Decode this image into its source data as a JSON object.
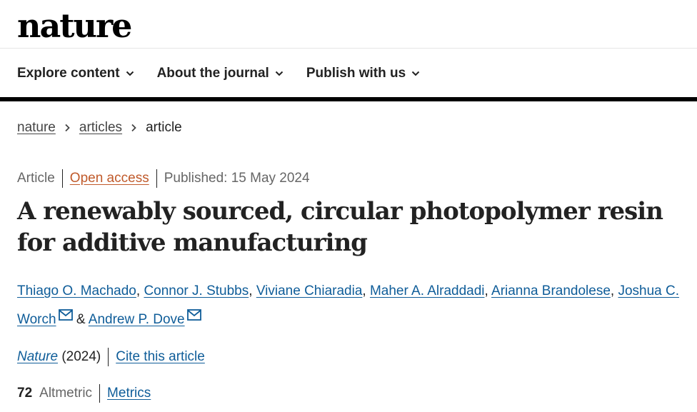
{
  "header": {
    "logo": "nature"
  },
  "nav": {
    "items": [
      {
        "label": "Explore content"
      },
      {
        "label": "About the journal"
      },
      {
        "label": "Publish with us"
      }
    ]
  },
  "breadcrumb": {
    "items": [
      "nature",
      "articles"
    ],
    "current": "article"
  },
  "article": {
    "type": "Article",
    "access": "Open access",
    "published": "Published: 15 May 2024",
    "title": "A renewably sourced, circular photopolymer resin for additive manufacturing",
    "authors": [
      "Thiago O. Machado",
      "Connor J. Stubbs",
      "Viviane Chiaradia",
      "Maher A. Alraddadi",
      "Arianna Brandolese",
      "Joshua C. Worch",
      "Andrew P. Dove"
    ],
    "author_separator": ",",
    "author_and": "&",
    "journal": "Nature",
    "year": "(2024)",
    "cite_label": "Cite this article",
    "altmetric_value": "72",
    "altmetric_label": "Altmetric",
    "metrics_label": "Metrics"
  },
  "colors": {
    "link": "#0f5d99",
    "open_access": "#c05a2b",
    "text": "#222222",
    "muted": "#666666"
  },
  "icons": {
    "nav_dropdown": "chevron-down-icon",
    "breadcrumb_separator": "chevron-right-icon",
    "author_contact": "mail-icon"
  }
}
